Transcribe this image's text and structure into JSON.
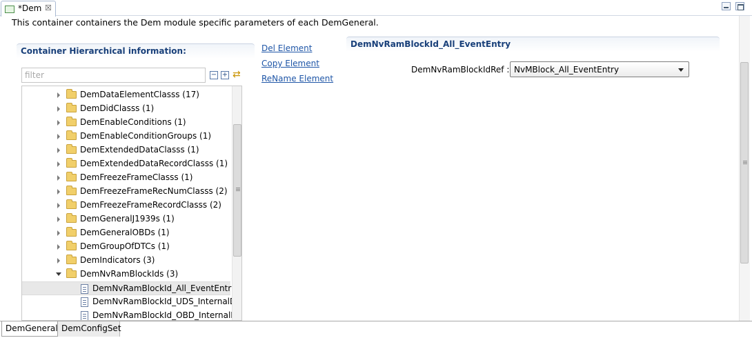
{
  "editor_tab": {
    "title": "*Dem",
    "close": "☒"
  },
  "description": "This container containers the Dem module specific parameters of each DemGeneral.",
  "left_section": {
    "title": "Container Hierarchical information:",
    "filter_placeholder": "filter",
    "collapse_all": "−",
    "expand_all": "+",
    "tree": [
      {
        "label": "DemDataElementClasss (17)",
        "kind": "folder",
        "expanded": false
      },
      {
        "label": "DemDidClasss (1)",
        "kind": "folder",
        "expanded": false
      },
      {
        "label": "DemEnableConditions (1)",
        "kind": "folder",
        "expanded": false
      },
      {
        "label": "DemEnableConditionGroups (1)",
        "kind": "folder",
        "expanded": false
      },
      {
        "label": "DemExtendedDataClasss (1)",
        "kind": "folder",
        "expanded": false
      },
      {
        "label": "DemExtendedDataRecordClasss (1)",
        "kind": "folder",
        "expanded": false
      },
      {
        "label": "DemFreezeFrameClasss (1)",
        "kind": "folder",
        "expanded": false
      },
      {
        "label": "DemFreezeFrameRecNumClasss (2)",
        "kind": "folder",
        "expanded": false
      },
      {
        "label": "DemFreezeFrameRecordClasss (2)",
        "kind": "folder",
        "expanded": false
      },
      {
        "label": "DemGeneralJ1939s (1)",
        "kind": "folder",
        "expanded": false
      },
      {
        "label": "DemGeneralOBDs (1)",
        "kind": "folder",
        "expanded": false
      },
      {
        "label": "DemGroupOfDTCs (1)",
        "kind": "folder",
        "expanded": false
      },
      {
        "label": "DemIndicators (3)",
        "kind": "folder",
        "expanded": false
      },
      {
        "label": "DemNvRamBlockIds (3)",
        "kind": "folder",
        "expanded": true
      },
      {
        "label": "DemNvRamBlockId_All_EventEntry",
        "kind": "leaf",
        "selected": true
      },
      {
        "label": "DemNvRamBlockId_UDS_InternalD",
        "kind": "leaf",
        "selected": false
      },
      {
        "label": "DemNvRamBlockId_OBD_InternalD",
        "kind": "leaf",
        "selected": false
      }
    ]
  },
  "actions": {
    "del": "Del Element",
    "copy": "Copy Element",
    "rename": "ReName Element"
  },
  "right_section": {
    "title": "DemNvRamBlockId_All_EventEntry",
    "field_label": "DemNvRamBlockIdRef :",
    "field_value": "NvMBlock_All_EventEntry"
  },
  "bottom_tabs": [
    "DemGeneral",
    "DemConfigSet"
  ],
  "colors": {
    "link": "#1f56a7",
    "section_title": "#19407a",
    "folder": "#f1cf6a"
  }
}
